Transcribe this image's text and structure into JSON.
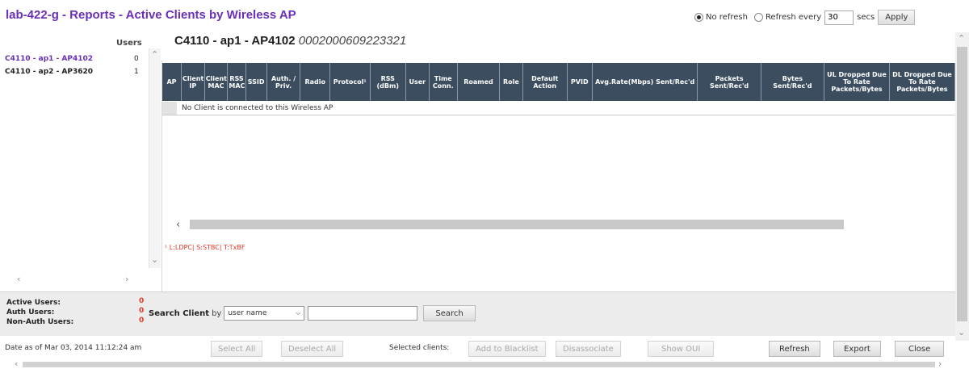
{
  "header": {
    "title": "lab-422-g - Reports - Active Clients by Wireless AP",
    "refresh": {
      "no_refresh_label": "No refresh",
      "no_refresh_selected": true,
      "refresh_every_label": "Refresh every",
      "interval_value": "30",
      "secs_label": "secs",
      "apply_label": "Apply"
    }
  },
  "ap_list": {
    "users_header": "Users",
    "items": [
      {
        "name": "C4110 - ap1 - AP4102",
        "users": "0",
        "selected": true,
        "color": "#6a2fb8"
      },
      {
        "name": "C4110 - ap2 - AP3620",
        "users": "1",
        "selected": false,
        "color": "#222222"
      }
    ]
  },
  "main": {
    "ap_name": "C4110 - ap1 - AP4102",
    "ap_serial": "0002000609223321",
    "columns": [
      "AP",
      "Client IP",
      "Client MAC",
      "RSS MAC",
      "SSID",
      "Auth. / Priv.",
      "Radio",
      "Protocol¹",
      "RSS (dBm)",
      "User",
      "Time Conn.",
      "Roamed",
      "Role",
      "Default Action",
      "PVID",
      "Avg.Rate(Mbps) Sent/Rec'd",
      "Packets Sent/Rec'd",
      "Bytes Sent/Rec'd",
      "UL Dropped Due To Rate Packets/Bytes",
      "DL Dropped Due To Rate Packets/Bytes"
    ],
    "empty_message": "No Client is connected to this Wireless AP",
    "legend": "¹ L:LDPC| S:STBC| T:TxBF"
  },
  "stats": {
    "active_users_label": "Active Users:",
    "active_users_value": "0",
    "auth_users_label": "Auth Users:",
    "auth_users_value": "0",
    "non_auth_users_label": "Non-Auth Users:",
    "non_auth_users_value": "0"
  },
  "search": {
    "label": "Search Client",
    "by_label": "by",
    "field_selected": "user name",
    "query": "",
    "button_label": "Search"
  },
  "footer": {
    "date_label": "Date as of Mar 03, 2014 11:12:24 am",
    "select_all": "Select All",
    "deselect_all": "Deselect All",
    "selected_clients_label": "Selected clients:",
    "add_to_blacklist": "Add to Blacklist",
    "disassociate": "Disassociate",
    "show_oui": "Show OUI",
    "refresh": "Refresh",
    "export": "Export",
    "close": "Close"
  },
  "colors": {
    "title": "#6a2fb8",
    "table_header": "#3c4d60",
    "alert_red": "#e03a2a"
  },
  "icons": [
    "radio-selected-icon",
    "radio-unselected-icon",
    "dropdown-arrow-icon",
    "scroll-left-arrow-icon",
    "scroll-right-arrow-icon",
    "scroll-up-arrow-icon",
    "scroll-down-arrow-icon"
  ]
}
